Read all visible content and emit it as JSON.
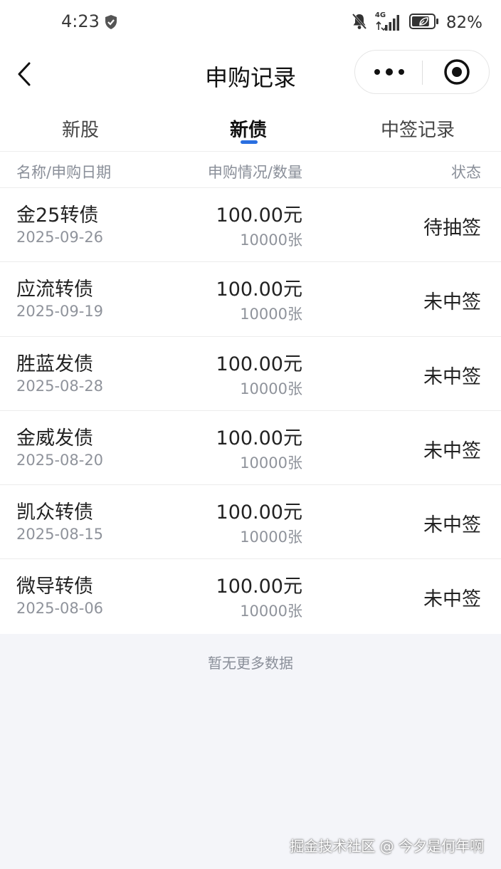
{
  "status_bar": {
    "time": "4:23",
    "network": "4G",
    "battery_percent": "82%",
    "battery_level": 0.82
  },
  "nav": {
    "title": "申购记录"
  },
  "tabs": [
    {
      "label": "新股",
      "active": false
    },
    {
      "label": "新债",
      "active": true
    },
    {
      "label": "中签记录",
      "active": false
    }
  ],
  "table_header": {
    "name_date": "名称/申购日期",
    "amount_qty": "申购情况/数量",
    "status": "状态"
  },
  "records": [
    {
      "name": "金25转债",
      "date": "2025-09-26",
      "amount": "100.00元",
      "qty": "10000张",
      "status": "待抽签"
    },
    {
      "name": "应流转债",
      "date": "2025-09-19",
      "amount": "100.00元",
      "qty": "10000张",
      "status": "未中签"
    },
    {
      "name": "胜蓝发债",
      "date": "2025-08-28",
      "amount": "100.00元",
      "qty": "10000张",
      "status": "未中签"
    },
    {
      "name": "金威发债",
      "date": "2025-08-20",
      "amount": "100.00元",
      "qty": "10000张",
      "status": "未中签"
    },
    {
      "name": "凯众转债",
      "date": "2025-08-15",
      "amount": "100.00元",
      "qty": "10000张",
      "status": "未中签"
    },
    {
      "name": "微导转债",
      "date": "2025-08-06",
      "amount": "100.00元",
      "qty": "10000张",
      "status": "未中签"
    }
  ],
  "footer": {
    "no_more": "暂无更多数据",
    "watermark": "掘金技术社区 @ 今夕是何年啊"
  },
  "colors": {
    "accent": "#2a6fe0",
    "background": "#f4f5f9"
  }
}
